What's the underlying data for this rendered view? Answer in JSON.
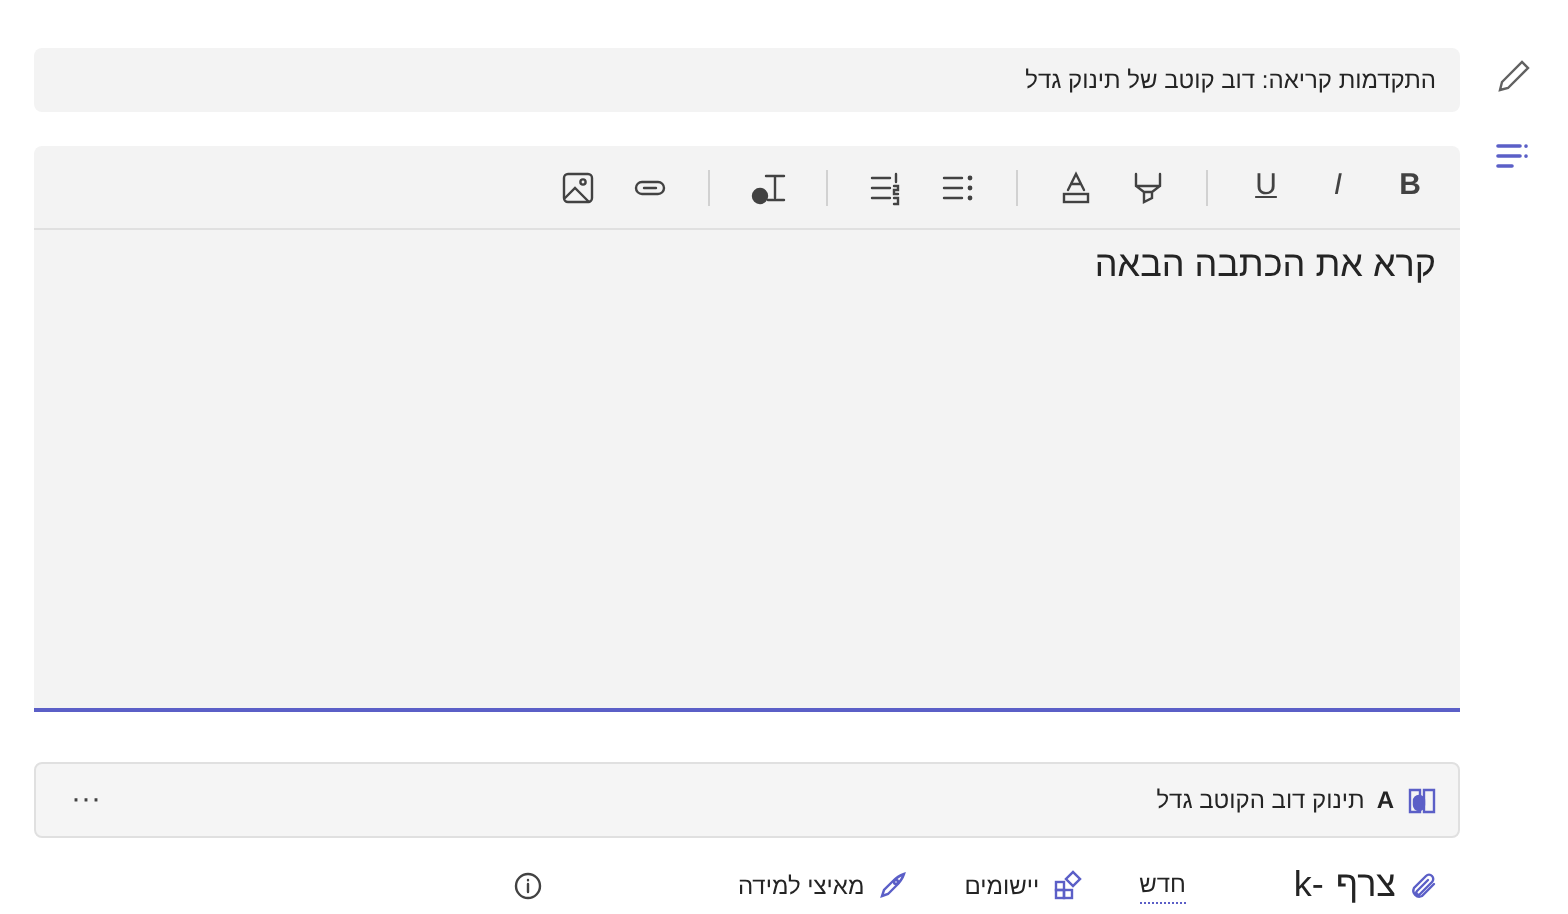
{
  "progress_banner": {
    "text": "התקדמות קריאה: דוב קוטב של תינוק גדל"
  },
  "toolbar": {
    "groups": [
      [
        {
          "kind": "bold",
          "label": "B"
        },
        {
          "kind": "italic",
          "label": "I"
        },
        {
          "kind": "underline",
          "label": "U"
        }
      ],
      [
        {
          "kind": "highlight"
        },
        {
          "kind": "font-color"
        }
      ],
      [
        {
          "kind": "bullets"
        },
        {
          "kind": "numbering"
        }
      ],
      [
        {
          "kind": "clear-format"
        }
      ],
      [
        {
          "kind": "link"
        },
        {
          "kind": "image"
        }
      ]
    ]
  },
  "editor": {
    "value": "קרא את הכתבה הבאה"
  },
  "attachment": {
    "letter": "A",
    "title": "תינוק דוב הקוטב גדל",
    "more": "···"
  },
  "actions": [
    {
      "kind": "attach",
      "label": "צרף",
      "shortcut": "k-"
    },
    {
      "kind": "new",
      "label": "חדש"
    },
    {
      "kind": "apps",
      "label": "יישומים"
    },
    {
      "kind": "accelerators",
      "label": "מאיצי למידה"
    },
    {
      "kind": "info"
    }
  ],
  "side_rail": [
    {
      "kind": "edit",
      "selected": false
    },
    {
      "kind": "list",
      "selected": true
    }
  ]
}
